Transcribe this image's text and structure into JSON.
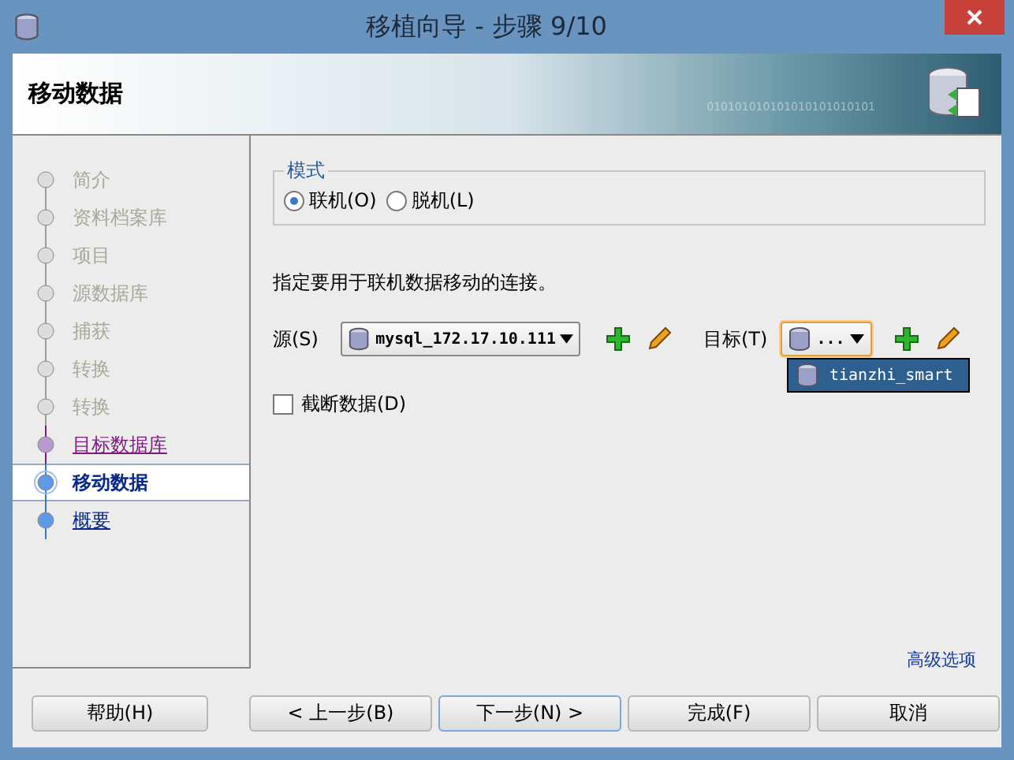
{
  "window": {
    "title": "移植向导 - 步骤 9/10"
  },
  "header": {
    "title": "移动数据",
    "banner_text": "010101010101010101010101"
  },
  "steps": [
    {
      "label": "简介",
      "kind": "done",
      "selected": false
    },
    {
      "label": "资料档案库",
      "kind": "done",
      "selected": false
    },
    {
      "label": "项目",
      "kind": "done",
      "selected": false
    },
    {
      "label": "源数据库",
      "kind": "done",
      "selected": false
    },
    {
      "label": "捕获",
      "kind": "done",
      "selected": false
    },
    {
      "label": "转换",
      "kind": "done",
      "selected": false
    },
    {
      "label": "转换",
      "kind": "done",
      "selected": false
    },
    {
      "label": "目标数据库",
      "kind": "visited",
      "selected": false
    },
    {
      "label": "移动数据",
      "kind": "current",
      "selected": true
    },
    {
      "label": "概要",
      "kind": "pending",
      "selected": false
    }
  ],
  "mode": {
    "legend": "模式",
    "options": [
      {
        "label": "联机(O)",
        "selected": true
      },
      {
        "label": "脱机(L)",
        "selected": false
      }
    ]
  },
  "instruction": "指定要用于联机数据移动的连接。",
  "source": {
    "label": "源(S)",
    "value": "mysql_172.17.10.111"
  },
  "target": {
    "label": "目标(T)",
    "value": "...",
    "focused": true,
    "options": [
      {
        "label": "tianzhi_smart",
        "selected": true
      }
    ]
  },
  "truncate": {
    "label": "截断数据(D)",
    "checked": false
  },
  "advanced_link": "高级选项",
  "buttons": [
    {
      "label": "帮助(H)",
      "kind": "help",
      "focused": false
    },
    {
      "label": "< 上一步(B)",
      "kind": "nav",
      "focused": false
    },
    {
      "label": "下一步(N) >",
      "kind": "nav",
      "focused": true
    },
    {
      "label": "完成(F)",
      "kind": "nav",
      "focused": false
    },
    {
      "label": "取消",
      "kind": "cancel",
      "focused": false
    }
  ]
}
